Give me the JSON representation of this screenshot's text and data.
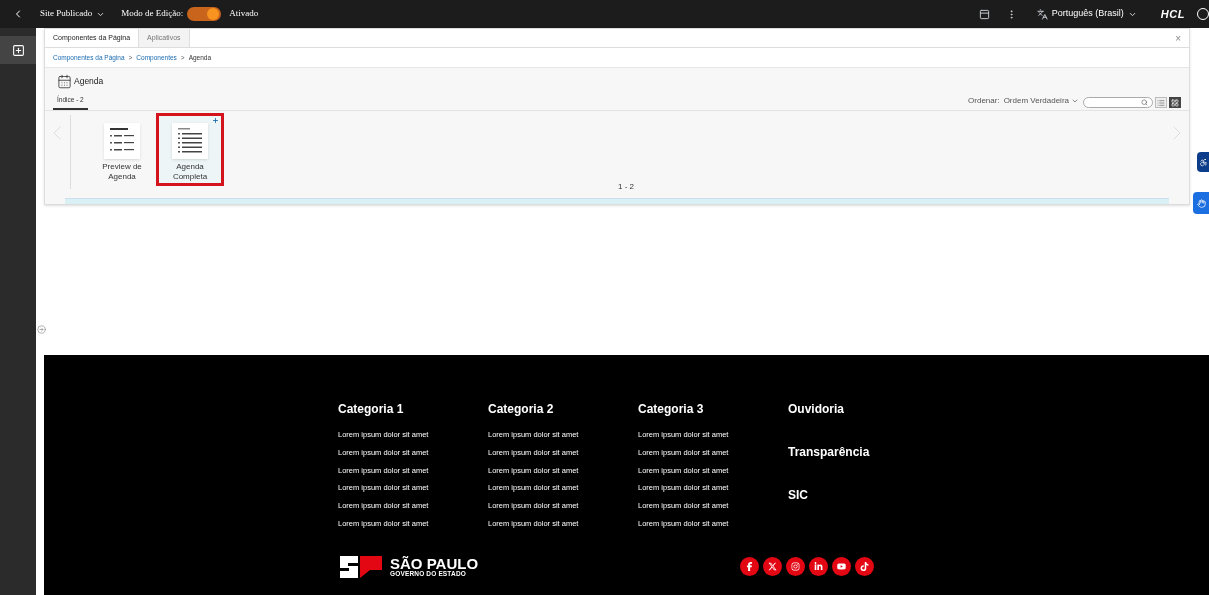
{
  "top_bar": {
    "site_status": "Site Publicado",
    "edit_mode": {
      "label": "Modo de Edição:",
      "on": true,
      "state_text": "Ativado"
    },
    "language": "Português (Brasil)",
    "brand": "HCL"
  },
  "panel": {
    "close": "×",
    "tabs": [
      {
        "label": "Componentes da Página",
        "selected": true
      },
      {
        "label": "Aplicativos",
        "selected": false
      }
    ],
    "breadcrumb": [
      {
        "label": "Componentes da Página"
      },
      {
        "label": "Componentes"
      },
      {
        "label": "Agenda"
      }
    ],
    "breadcrumb_separator": ">",
    "title": "Agenda",
    "index_tab": "Índice - 2",
    "sort": {
      "label": "Ordenar:",
      "value": "Ordem Verdadeira"
    },
    "views": [
      {
        "kind": "list",
        "selected": false
      },
      {
        "kind": "grid",
        "selected": true
      }
    ],
    "items": [
      {
        "label": "Preview de Agenda",
        "kind": "preview",
        "selected": false
      },
      {
        "label": "Agenda Completa",
        "kind": "full",
        "selected": true
      }
    ],
    "pager": "1 - 2"
  },
  "footer": {
    "columns": [
      {
        "title": "Categoria 1",
        "links": [
          "Lorem ipsum dolor sit amet",
          "Lorem ipsum dolor sit amet",
          "Lorem ipsum dolor sit amet",
          "Lorem ipsum dolor sit amet",
          "Lorem ipsum dolor sit amet",
          "Lorem ipsum dolor sit amet"
        ]
      },
      {
        "title": "Categoria 2",
        "links": [
          "Lorem ipsum dolor sit amet",
          "Lorem ipsum dolor sit amet",
          "Lorem ipsum dolor sit amet",
          "Lorem ipsum dolor sit amet",
          "Lorem ipsum dolor sit amet",
          "Lorem ipsum dolor sit amet"
        ]
      },
      {
        "title": "Categoria 3",
        "links": [
          "Lorem ipsum dolor sit amet",
          "Lorem ipsum dolor sit amet",
          "Lorem ipsum dolor sit amet",
          "Lorem ipsum dolor sit amet",
          "Lorem ipsum dolor sit amet",
          "Lorem ipsum dolor sit amet"
        ]
      }
    ],
    "main_links": [
      "Ouvidoria",
      "Transparência",
      "SIC"
    ],
    "logo": {
      "title": "SÃO PAULO",
      "subtitle": "GOVERNO DO ESTADO"
    },
    "social": [
      {
        "kind": "facebook"
      },
      {
        "kind": "x"
      },
      {
        "kind": "instagram"
      },
      {
        "kind": "linkedin"
      },
      {
        "kind": "youtube"
      },
      {
        "kind": "tiktok"
      }
    ]
  }
}
